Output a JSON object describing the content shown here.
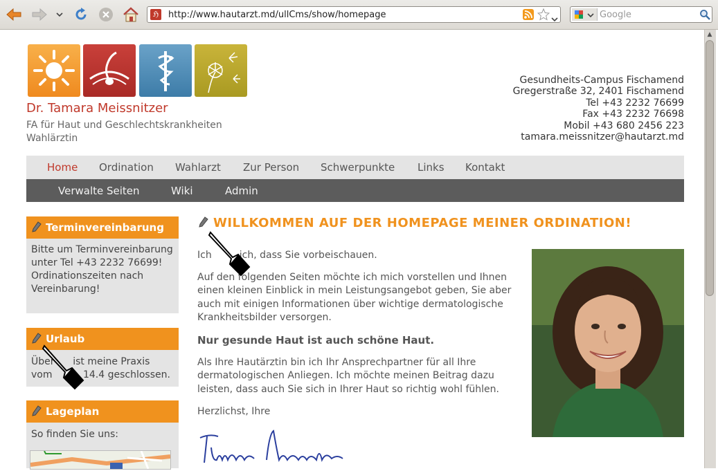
{
  "browser": {
    "url": "http://www.hautarzt.md/ullCms/show/homepage",
    "search_placeholder": "Google"
  },
  "site": {
    "name": "Dr. Tamara Meissnitzer",
    "subtitle1": "FA für Haut und Geschlechtskrankheiten",
    "subtitle2": "Wahlärztin"
  },
  "contact": {
    "line1": "Gesundheits-Campus Fischamend",
    "line2": "Gregerstraße 32, 2401 Fischamend",
    "line3": "Tel +43 2232 76699",
    "line4": "Fax +43 2232 76698",
    "line5": "Mobil +43 680 2456 223",
    "line6": "tamara.meissnitzer@hautarzt.md"
  },
  "nav": {
    "items": [
      "Home",
      "Ordination",
      "Wahlarzt",
      "Zur Person",
      "Schwerpunkte",
      "Links",
      "Kontakt"
    ],
    "admin_items": [
      "Verwalte Seiten",
      "Wiki",
      "Admin"
    ]
  },
  "sidebar": {
    "termin_title": "Terminvereinbarung",
    "termin_lines": [
      "Bitte um Terminvereinbarung",
      "unter Tel +43 2232 76699!",
      "Ordinationszeiten nach",
      "Vereinbarung!"
    ],
    "urlaub_title": "Urlaub",
    "urlaub_lines": [
      "Über      ist meine Praxis",
      "vom          14.4 geschlossen."
    ],
    "lageplan_title": "Lageplan",
    "lageplan_text": "So finden Sie uns:"
  },
  "main": {
    "title": "WILLKOMMEN AUF DER HOMEPAGE MEINER ORDINATION!",
    "intro": "Ich         ich, dass Sie vorbeischauen.",
    "para1": [
      "Auf den folgenden Seiten möchte ich mich vorstellen und Ihnen",
      "einen kleinen Einblick in mein Leistungsangebot geben, Sie aber",
      "auch mit einigen Informationen über wichtige dermatologische",
      "Krankheitsbilder versorgen."
    ],
    "slogan": "Nur gesunde Haut ist auch schöne Haut.",
    "para2": [
      "Als Ihre Hautärztin bin ich Ihr Ansprechpartner für all Ihre",
      "dermatologischen Anliegen. Ich möchte meinen Beitrag dazu",
      "leisten, dass auch Sie sich in Ihrer Haut so richtig wohl fühlen."
    ],
    "closing": "Herzlichst, Ihre",
    "signature": "Tamara Meissnitzer"
  },
  "colors": {
    "accent": "#f0921e",
    "brand_red": "#c0392b",
    "nav_bg": "#e4e4e4",
    "admin_bg": "#5c5c5c"
  }
}
